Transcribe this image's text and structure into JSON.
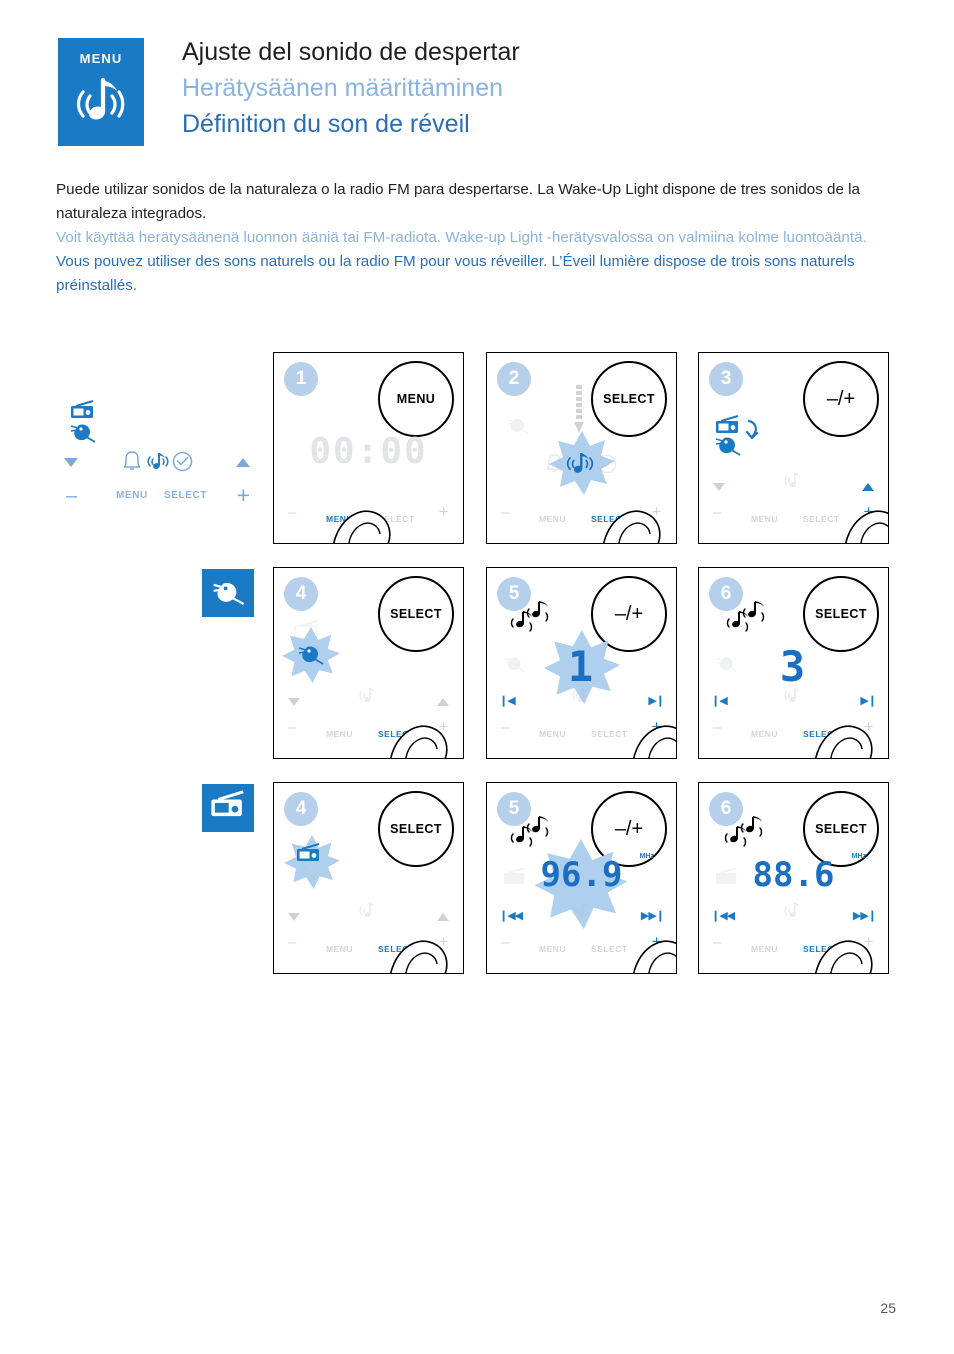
{
  "header": {
    "badge_label": "MENU",
    "badge_icon": "music-note-sound-icon",
    "title_es": "Ajuste del sonido de despertar",
    "title_fi": "Herätysäänen määrittäminen",
    "title_fr": "Définition du son de réveil"
  },
  "intro": {
    "es": "Puede utilizar sonidos de la naturaleza o la radio FM para despertarse. La Wake-Up Light dispone de tres sonidos de la naturaleza integrados.",
    "fi": "Voit käyttää herätysäänenä luonnon ääniä tai FM-radiota. Wake-up Light -herätysvalossa on valmiina kolme luontoääntä.",
    "fr": "Vous pouvez utiliser des sons naturels ou la radio FM pour vous réveiller. L’Éveil lumière dispose de trois sons naturels préinstallés."
  },
  "legend": {
    "icons": [
      "radio-icon",
      "bird-icon"
    ],
    "status_icons": [
      "bell-icon",
      "music-note-icon",
      "clock-icon"
    ],
    "down_arrow": "triangle-down-icon",
    "up_arrow": "triangle-up-icon",
    "minus": "–",
    "menu_label": "MENU",
    "select_label": "SELECT",
    "plus": "+"
  },
  "rows": [
    {
      "badge": null,
      "panels": [
        {
          "step": "1",
          "knob": "MENU",
          "display": "00:00",
          "active_control": "MENU"
        },
        {
          "step": "2",
          "knob": "SELECT",
          "display": "",
          "active_control": "SELECT"
        },
        {
          "step": "3",
          "knob": "–/+",
          "display": "",
          "active_control": "+"
        }
      ]
    },
    {
      "badge": "bird-icon",
      "panels": [
        {
          "step": "4",
          "knob": "SELECT",
          "display": "",
          "active_control": "SELECT"
        },
        {
          "step": "5",
          "knob": "–/+",
          "display": "1",
          "active_control": "+"
        },
        {
          "step": "6",
          "knob": "SELECT",
          "display": "3",
          "active_control": "SELECT"
        }
      ]
    },
    {
      "badge": "radio-icon",
      "panels": [
        {
          "step": "4",
          "knob": "SELECT",
          "display": "",
          "active_control": "SELECT"
        },
        {
          "step": "5",
          "knob": "–/+",
          "display": "96.9",
          "unit": "MHz",
          "active_control": "+"
        },
        {
          "step": "6",
          "knob": "SELECT",
          "display": "88.6",
          "unit": "MHz",
          "active_control": "SELECT"
        }
      ]
    }
  ],
  "controls": {
    "minus": "–",
    "plus": "+",
    "menu": "MENU",
    "select": "SELECT"
  },
  "footer": {
    "page": "25"
  },
  "colors": {
    "brand_blue": "#1a7ac4",
    "light_blue": "#8bb3e0",
    "french_blue": "#2a6ebb",
    "badge_blue": "#b6d0ec",
    "grey_text": "#d2d6da",
    "black": "#231f20"
  }
}
